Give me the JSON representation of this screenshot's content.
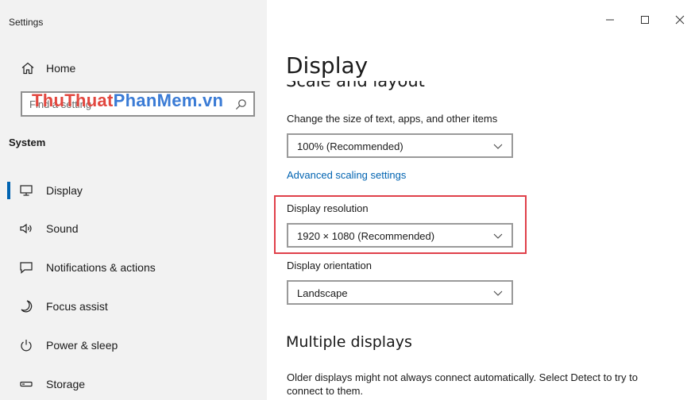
{
  "app": {
    "title": "Settings"
  },
  "window_controls": {
    "minimize": "—",
    "maximize": "☐",
    "close": "✕"
  },
  "sidebar": {
    "home_label": "Home",
    "search_placeholder": "Find a setting",
    "watermark_part1": "ThuThuat",
    "watermark_part2": "PhanMem.vn",
    "section": "System",
    "items": [
      {
        "label": "Display",
        "icon": "monitor-icon",
        "active": true
      },
      {
        "label": "Sound",
        "icon": "speaker-icon"
      },
      {
        "label": "Notifications & actions",
        "icon": "notification-icon"
      },
      {
        "label": "Focus assist",
        "icon": "moon-icon"
      },
      {
        "label": "Power & sleep",
        "icon": "power-icon"
      },
      {
        "label": "Storage",
        "icon": "storage-icon"
      }
    ]
  },
  "main": {
    "title": "Display",
    "section_partial": "Scale and layout",
    "scale": {
      "label": "Change the size of text, apps, and other items",
      "value": "100% (Recommended)"
    },
    "advanced_link": "Advanced scaling settings",
    "resolution": {
      "label": "Display resolution",
      "value": "1920 × 1080 (Recommended)"
    },
    "orientation": {
      "label": "Display orientation",
      "value": "Landscape"
    },
    "multiple_displays": {
      "heading": "Multiple displays",
      "text": "Older displays might not always connect automatically. Select Detect to try to connect to them."
    }
  },
  "colors": {
    "accent": "#0063b1",
    "highlight_border": "#e0404a",
    "sidebar_bg": "#f2f2f2"
  }
}
